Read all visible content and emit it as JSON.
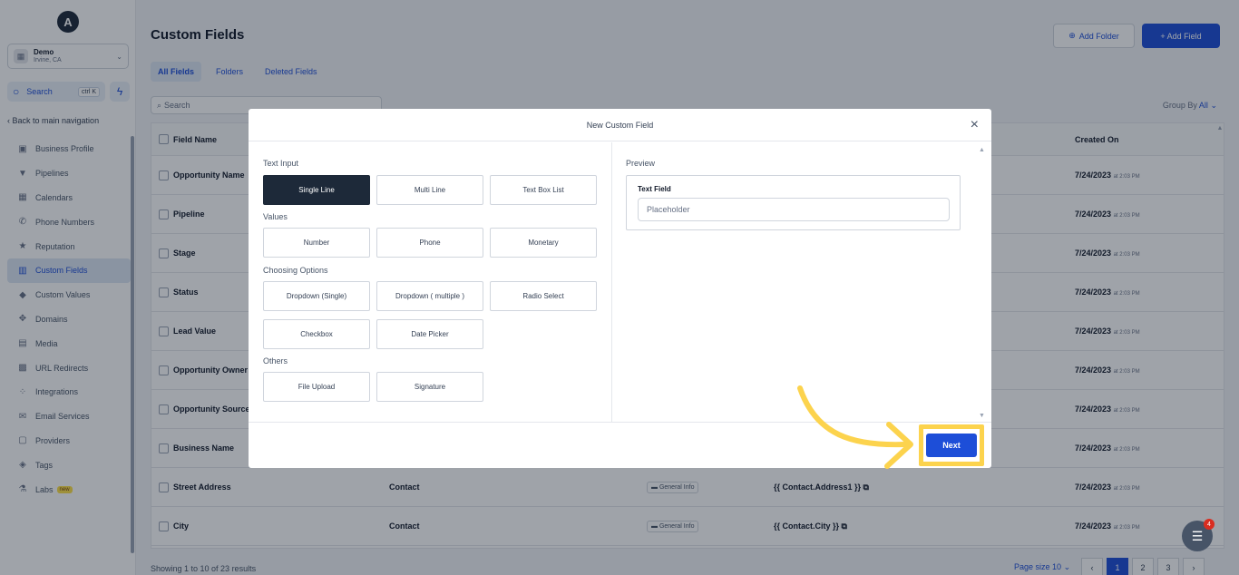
{
  "sidebar": {
    "logo_letter": "A",
    "location": {
      "name": "Demo",
      "sub": "Irvine, CA"
    },
    "search_label": "Search",
    "search_shortcut": "ctrl K",
    "back_label": "Back to main navigation",
    "new_badge": "new",
    "items": [
      {
        "label": "Business Profile",
        "icon": "briefcase-icon"
      },
      {
        "label": "Pipelines",
        "icon": "filter-icon"
      },
      {
        "label": "Calendars",
        "icon": "calendar-icon"
      },
      {
        "label": "Phone Numbers",
        "icon": "phone-icon"
      },
      {
        "label": "Reputation",
        "icon": "star-icon"
      },
      {
        "label": "Custom Fields",
        "icon": "fields-icon",
        "active": true
      },
      {
        "label": "Custom Values",
        "icon": "diamond-icon"
      },
      {
        "label": "Domains",
        "icon": "globe-icon"
      },
      {
        "label": "Media",
        "icon": "image-icon"
      },
      {
        "label": "URL Redirects",
        "icon": "link-icon"
      },
      {
        "label": "Integrations",
        "icon": "puzzle-icon"
      },
      {
        "label": "Email Services",
        "icon": "mail-icon"
      },
      {
        "label": "Providers",
        "icon": "server-icon"
      },
      {
        "label": "Tags",
        "icon": "tag-icon"
      },
      {
        "label": "Labs",
        "icon": "flask-icon"
      }
    ]
  },
  "header": {
    "title": "Custom Fields",
    "add_folder": "Add Folder",
    "add_field": "+ Add Field"
  },
  "tabs": [
    "All Fields",
    "Folders",
    "Deleted Fields"
  ],
  "search": {
    "placeholder": "Search"
  },
  "group_by": {
    "label": "Group By",
    "value": "All"
  },
  "table": {
    "headers": {
      "name": "Field Name",
      "created": "Created On"
    },
    "rows": [
      {
        "name": "Opportunity Name",
        "object": "",
        "folder": "",
        "key": "",
        "date": "7/24/2023",
        "time": "at 2:03 PM"
      },
      {
        "name": "Pipeline",
        "object": "",
        "folder": "",
        "key": "",
        "date": "7/24/2023",
        "time": "at 2:03 PM"
      },
      {
        "name": "Stage",
        "object": "",
        "folder": "",
        "key": "",
        "date": "7/24/2023",
        "time": "at 2:03 PM"
      },
      {
        "name": "Status",
        "object": "",
        "folder": "",
        "key": "",
        "date": "7/24/2023",
        "time": "at 2:03 PM"
      },
      {
        "name": "Lead Value",
        "object": "",
        "folder": "",
        "key": "",
        "date": "7/24/2023",
        "time": "at 2:03 PM"
      },
      {
        "name": "Opportunity Owner",
        "object": "",
        "folder": "",
        "key": "",
        "date": "7/24/2023",
        "time": "at 2:03 PM"
      },
      {
        "name": "Opportunity Source",
        "object": "",
        "folder": "",
        "key": "",
        "date": "7/24/2023",
        "time": "at 2:03 PM"
      },
      {
        "name": "Business Name",
        "object": "",
        "folder": "",
        "key": "",
        "date": "7/24/2023",
        "time": "at 2:03 PM"
      },
      {
        "name": "Street Address",
        "object": "Contact",
        "folder": "General Info",
        "key": "{{ Contact.Address1 }}",
        "date": "7/24/2023",
        "time": "at 2:03 PM"
      },
      {
        "name": "City",
        "object": "Contact",
        "folder": "General Info",
        "key": "{{ Contact.City }}",
        "date": "7/24/2023",
        "time": "at 2:03 PM"
      }
    ]
  },
  "footer": {
    "showing": "Showing 1 to 10 of 23 results",
    "page_size_label": "Page size",
    "page_size_value": "10",
    "pages": [
      "‹",
      "1",
      "2",
      "3",
      "›"
    ]
  },
  "modal": {
    "title": "New Custom Field",
    "close": "×",
    "sections": {
      "text_input": "Text Input",
      "values": "Values",
      "choosing": "Choosing Options",
      "others": "Others"
    },
    "options": {
      "single_line": "Single Line",
      "multi_line": "Multi Line",
      "text_box_list": "Text Box List",
      "number": "Number",
      "phone": "Phone",
      "monetary": "Monetary",
      "dropdown_single": "Dropdown (Single)",
      "dropdown_multiple": "Dropdown ( multiple )",
      "radio_select": "Radio Select",
      "checkbox": "Checkbox",
      "date_picker": "Date Picker",
      "file_upload": "File Upload",
      "signature": "Signature"
    },
    "preview": {
      "label": "Preview",
      "field_label": "Text Field",
      "placeholder": "Placeholder"
    },
    "next": "Next"
  },
  "chat": {
    "badge": "4"
  },
  "colors": {
    "accent": "#1d4ed8",
    "highlight": "#fcd34d",
    "selected": "#1d2939"
  }
}
